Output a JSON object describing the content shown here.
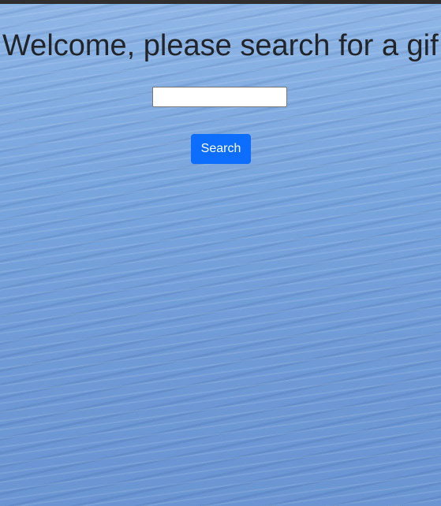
{
  "header": {
    "title": "Welcome, please search for a gif"
  },
  "search": {
    "value": "",
    "placeholder": "",
    "button_label": "Search"
  },
  "colors": {
    "top_bar": "#2f2f2f",
    "title_text": "#212529",
    "button_bg": "#0d6efd",
    "button_text": "#ffffff",
    "background": "#7aa6de"
  }
}
